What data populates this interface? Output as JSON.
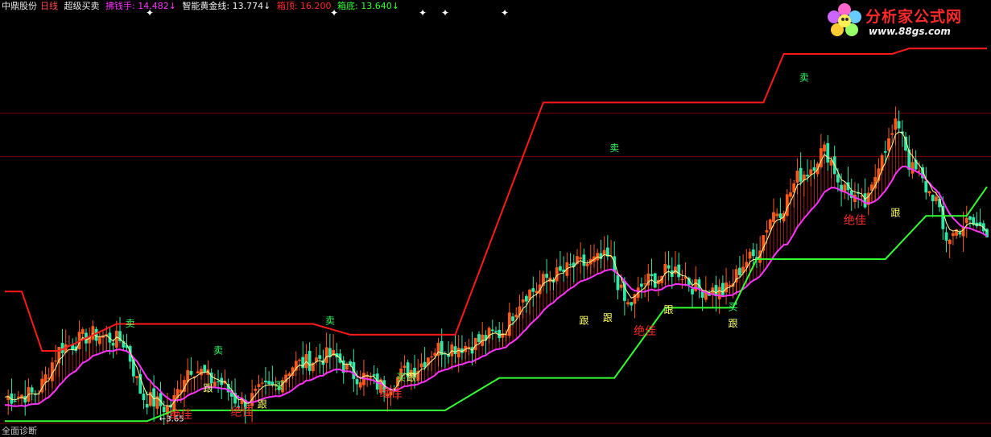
{
  "header": {
    "stock_name": "中鼎股份",
    "period": "日线",
    "indicator_name": "超级买卖",
    "param1_label": "拂钱手: ",
    "param1_value": "14.482↓",
    "param2_label": "智能黄金线: ",
    "param2_value": "13.774↓",
    "param3_label": "箱顶: ",
    "param3_value": "16.200",
    "param4_label": "箱底: ",
    "param4_value": "13.640↓"
  },
  "logo": {
    "title": "分析家公式网",
    "url": "www.88gs.com"
  },
  "footer": {
    "label": "全面诊断"
  },
  "colors": {
    "background": "#000000",
    "up_candle": "#ff5a1a",
    "down_candle": "#2ee8a8",
    "box_top": "#ff1a1a",
    "box_bottom": "#33ff33",
    "lucky_hand": "#ff33ff",
    "gold_line": "#ffff99",
    "signal_sell": "#33ff66",
    "signal_buy": "#33ff66",
    "signal_follow": "#ffff66",
    "signal_best": "#ff2a2a"
  },
  "chart_data": {
    "type": "candlestick",
    "ylim": [
      9.2,
      16.8
    ],
    "grid_levels": [
      15.0,
      14.2
    ],
    "low_marker": "3.65",
    "box_top_steps": [
      [
        0,
        11.7
      ],
      [
        5,
        11.7
      ],
      [
        11,
        10.6
      ],
      [
        16,
        10.6
      ],
      [
        33,
        11.1
      ],
      [
        91,
        11.1
      ],
      [
        102,
        10.9
      ],
      [
        133,
        10.9
      ],
      [
        159,
        15.2
      ],
      [
        224,
        15.2
      ],
      [
        230,
        16.1
      ],
      [
        262,
        16.1
      ],
      [
        267,
        16.2
      ],
      [
        290,
        16.2
      ]
    ],
    "box_bottom_steps": [
      [
        0,
        9.3
      ],
      [
        42,
        9.3
      ],
      [
        50,
        9.5
      ],
      [
        130,
        9.5
      ],
      [
        146,
        10.1
      ],
      [
        180,
        10.1
      ],
      [
        195,
        11.4
      ],
      [
        215,
        11.4
      ],
      [
        222,
        12.3
      ],
      [
        260,
        12.3
      ],
      [
        272,
        13.1
      ],
      [
        284,
        13.1
      ],
      [
        290,
        13.64
      ]
    ],
    "markers": [
      {
        "type": "卖",
        "x": 37,
        "y": 11.05
      },
      {
        "type": "卖",
        "x": 63,
        "y": 10.55
      },
      {
        "type": "跟",
        "x": 60,
        "y": 9.85
      },
      {
        "type": "绝佳",
        "x": 52,
        "y": 9.35
      },
      {
        "type": "绝佳",
        "x": 70,
        "y": 9.4
      },
      {
        "type": "跟",
        "x": 76,
        "y": 9.55
      },
      {
        "type": "买",
        "x": 81,
        "y": 9.9
      },
      {
        "type": "卖",
        "x": 96,
        "y": 11.1
      },
      {
        "type": "绝佳",
        "x": 114,
        "y": 9.75
      },
      {
        "type": "买",
        "x": 117,
        "y": 10.05
      },
      {
        "type": "跟",
        "x": 120,
        "y": 10.05
      },
      {
        "type": "跟",
        "x": 171,
        "y": 11.1
      },
      {
        "type": "跟",
        "x": 178,
        "y": 11.15
      },
      {
        "type": "卖",
        "x": 180,
        "y": 14.3
      },
      {
        "type": "绝佳",
        "x": 189,
        "y": 10.9
      },
      {
        "type": "跟",
        "x": 196,
        "y": 11.3
      },
      {
        "type": "买",
        "x": 215,
        "y": 11.35
      },
      {
        "type": "跟",
        "x": 215,
        "y": 11.05
      },
      {
        "type": "卖",
        "x": 236,
        "y": 15.6
      },
      {
        "type": "绝佳",
        "x": 251,
        "y": 12.95
      },
      {
        "type": "跟",
        "x": 263,
        "y": 13.1
      }
    ]
  }
}
